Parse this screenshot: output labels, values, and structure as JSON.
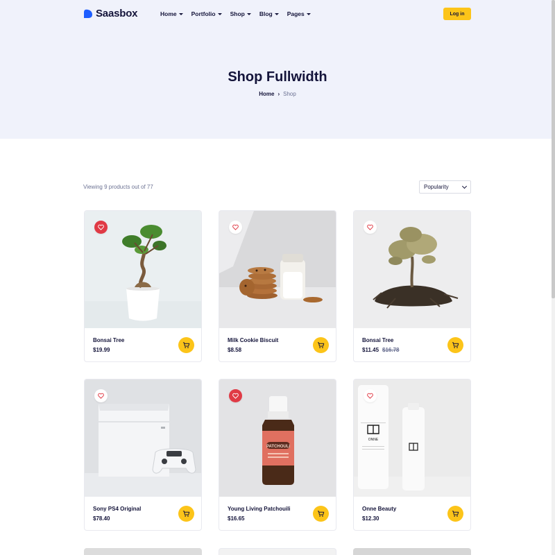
{
  "brand": {
    "name": "Saasbox",
    "accent": "#fcc419",
    "logo_color": "#1e5eff"
  },
  "nav": {
    "items": [
      {
        "label": "Home"
      },
      {
        "label": "Portfolio"
      },
      {
        "label": "Shop"
      },
      {
        "label": "Blog"
      },
      {
        "label": "Pages"
      }
    ],
    "login_label": "Log in"
  },
  "hero": {
    "title": "Shop Fullwidth",
    "breadcrumb": {
      "home": "Home",
      "separator": "›",
      "current": "Shop"
    }
  },
  "toolbar": {
    "viewing_text": "Viewing 9 products out of 77",
    "sort_selected": "Popularity"
  },
  "products": [
    {
      "name": "Bonsai Tree",
      "price": "$19.99",
      "old_price": "",
      "favorited": true,
      "image": "bonsai-tree-in-white-pot"
    },
    {
      "name": "Milk Cookie Biscuit",
      "price": "$8.58",
      "old_price": "",
      "favorited": false,
      "image": "cookies-and-milk-bottle"
    },
    {
      "name": "Bonsai Tree",
      "price": "$11.45",
      "old_price": "$16.78",
      "favorited": false,
      "image": "tree-with-soil-roots"
    },
    {
      "name": "Sony PS4 Original",
      "price": "$78.40",
      "old_price": "",
      "favorited": false,
      "image": "white-ps4-console-and-controller"
    },
    {
      "name": "Young Living Patchouili",
      "price": "$16.65",
      "old_price": "",
      "favorited": true,
      "image": "patchouli-oil-bottle",
      "label_text": "PATCHOULI"
    },
    {
      "name": "Onne Beauty",
      "price": "$12.30",
      "old_price": "",
      "favorited": false,
      "image": "onne-beauty-bottles",
      "label_text": "ONNE"
    }
  ],
  "icons": {
    "heart": "heart-icon",
    "cart": "cart-icon",
    "caret": "chevron-down-icon"
  }
}
